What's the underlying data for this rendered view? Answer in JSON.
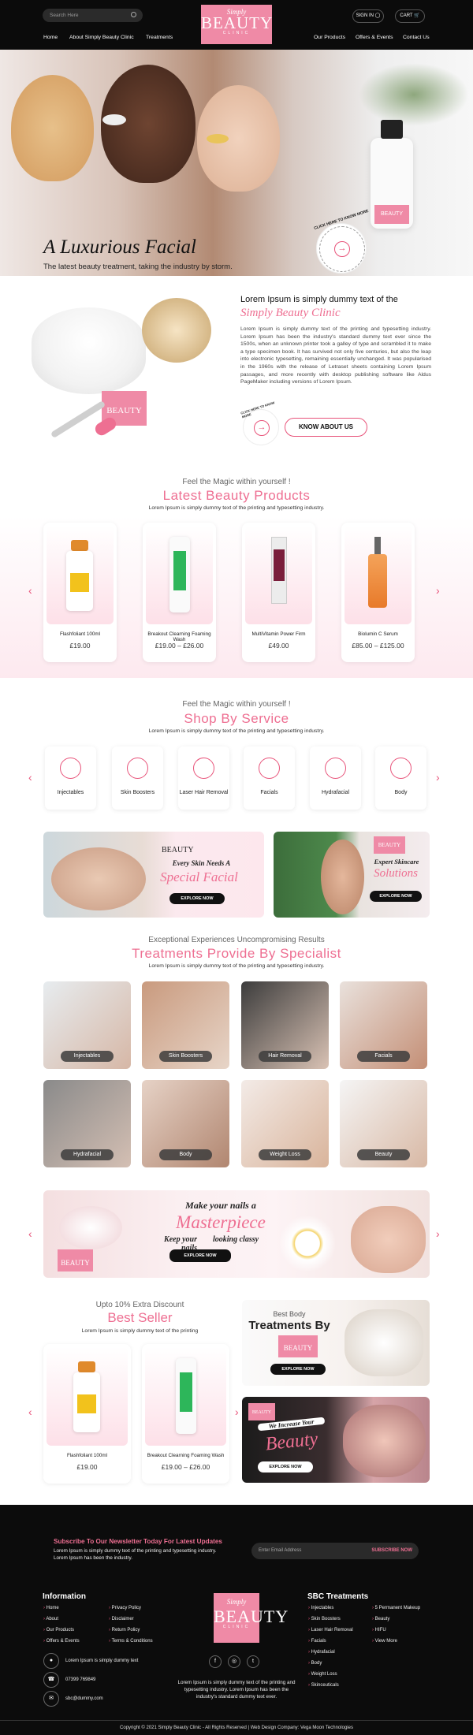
{
  "header": {
    "search_placeholder": "Search Here",
    "logo_script": "Simply",
    "logo_main": "BEAUTY",
    "logo_sub": "CLINIC",
    "sign_in": "SIGN IN",
    "cart": "CART",
    "nav_left": [
      "Home",
      "About Simply Beauty Clinic",
      "Treatments"
    ],
    "nav_right": [
      "Our Products",
      "Offers & Events",
      "Contact Us"
    ]
  },
  "hero": {
    "title": "A Luxurious Facial",
    "subtitle": "The latest beauty treatment, taking the industry by storm.",
    "circle_text": "CLICK HERE TO KNOW MORE",
    "product_label": "BEAUTY"
  },
  "about": {
    "heading": "Lorem Ipsum is simply dummy text of the",
    "heading_script": "Simply Beauty Clinic",
    "paragraph": "Lorem Ipsum is simply dummy text of the printing and typesetting industry. Lorem Ipsum has been the industry's standard dummy text ever since the 1500s, when an unknown printer took a galley of type and scrambled it to make a type specimen book. It has survived not only five centuries, but also the leap into electronic typesetting, remaining essentially unchanged. It was popularised in the 1960s with the release of Letraset sheets containing Lorem Ipsum passages, and more recently with desktop publishing software like Aldus PageMaker including versions of Lorem Ipsum.",
    "button": "KNOW ABOUT US",
    "circle_text": "CLICK HERE TO KNOW MORE",
    "jar_label": "BEAUTY"
  },
  "products": {
    "kicker": "Feel the Magic within yourself !",
    "title": "Latest Beauty Products",
    "desc": "Lorem Ipsum is simply dummy text of the printing and typesetting industry.",
    "items": [
      {
        "name": "Flashfoliant 100ml",
        "price": "£19.00"
      },
      {
        "name": "Breakout Clearning Foaming Wash",
        "price": "£19.00 – £26.00"
      },
      {
        "name": "MultiVitamin Power Firm",
        "price": "£49.00"
      },
      {
        "name": "Biolumin C Serum",
        "price": "£85.00 – £125.00"
      }
    ]
  },
  "services": {
    "kicker": "Feel the Magic within yourself !",
    "title": "Shop By Service",
    "desc": "Lorem Ipsum is simply dummy text of the printing and typesetting industry.",
    "items": [
      "Injectables",
      "Skin Boosters",
      "Laser Hair Removal",
      "Facials",
      "Hydrafacial",
      "Body"
    ]
  },
  "banners": [
    {
      "line1": "Every Skin Needs A",
      "line2": "Special Facial",
      "button": "EXPLORE NOW"
    },
    {
      "line1": "Expert Skincare",
      "line2": "Solutions",
      "button": "EXPLORE NOW"
    }
  ],
  "treatments": {
    "kicker": "Exceptional Experiences Uncompromising Results",
    "title": "Treatments Provide By Specialist",
    "desc": "Lorem Ipsum is simply dummy text of the printing and typesetting industry.",
    "items": [
      "Injectables",
      "Skin Boosters",
      "Hair Removal",
      "Facials",
      "Hydrafacial",
      "Body",
      "Weight Loss",
      "Beauty"
    ]
  },
  "nails": {
    "line1": "Make your nails a",
    "line2": "Masterpiece",
    "line3": "Keep your nails",
    "line4": "looking classy",
    "button": "EXPLORE NOW"
  },
  "bestseller": {
    "kicker": "Upto 10% Extra Discount",
    "title": "Best Seller",
    "desc": "Lorem Ipsum is simply dummy text of the printing",
    "items": [
      {
        "name": "Flashfoliant 100ml",
        "price": "£19.00"
      },
      {
        "name": "Breakout Clearning Foaming Wash",
        "price": "£19.00 – £26.00"
      }
    ],
    "promo1_kicker": "Best Body",
    "promo1_title": "Treatments By",
    "promo1_button": "EXPLORE NOW",
    "promo2_kicker": "We Increase Your",
    "promo2_title": "Beauty",
    "promo2_button": "EXPLORE NOW"
  },
  "footer": {
    "newsletter_title": "Subscribe To Our Newsletter Today For Latest Updates",
    "newsletter_desc": "Lorem Ipsum is simply dummy text of the printing and typesetting industry. Lorem Ipsum has been the industry.",
    "email_placeholder": "Enter Email Address",
    "subscribe": "SUBSCRIBE NOW",
    "info_title": "Information",
    "info_col1": [
      "Home",
      "About",
      "Our Products",
      "Offers & Events"
    ],
    "info_col2": [
      "Privacy Policy",
      "Disclaimer",
      "Return Policy",
      "Terms & Conditions"
    ],
    "address": "Lorem Ipsum is simply dummy text",
    "phone": "07399 769849",
    "email": "sbc@dummy.com",
    "center_text": "Lorem Ipsum is simply dummy text of the printing and typesetting industry. Lorem Ipsum has been the industry's standard dummy text ever.",
    "treat_title": "SBC Treatments",
    "treat_col1": [
      "Injectables",
      "Skin Boosters",
      "Laser Hair Removal",
      "Facials",
      "Hydrafacial",
      "Body",
      "Weight Loss",
      "Skinceuticals"
    ],
    "treat_col2": [
      "5 Permanent Makeup",
      "Beauty",
      "HIFU",
      "View More"
    ],
    "copyright": "Copyright © 2021 Simply Beauty Clinic - All Rights Reserved  |  Web Design Company: Vega Moon Technologies",
    "social": [
      "f",
      "◎",
      "t"
    ]
  },
  "colors": {
    "accent": "#e8537a",
    "logo_bg": "#ef8aa6",
    "dark": "#0b0b0b"
  }
}
